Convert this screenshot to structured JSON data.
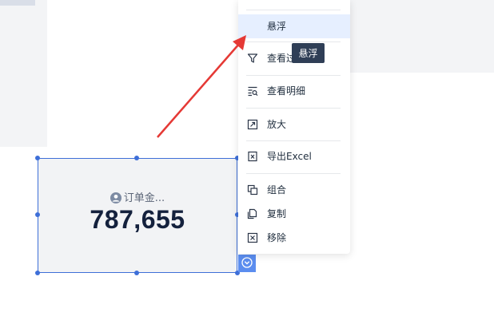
{
  "widget": {
    "label": "订单金...",
    "value": "787,655"
  },
  "menu": {
    "items": [
      {
        "label": "悬浮",
        "icon": "none"
      },
      {
        "label": "查看过",
        "icon": "filter-icon"
      },
      {
        "label": "查看明细",
        "icon": "details-icon"
      },
      {
        "label": "放大",
        "icon": "expand-icon"
      },
      {
        "label": "导出Excel",
        "icon": "excel-icon"
      },
      {
        "label": "组合",
        "icon": "group-icon"
      },
      {
        "label": "复制",
        "icon": "copy-icon"
      },
      {
        "label": "移除",
        "icon": "remove-icon"
      }
    ]
  },
  "tooltip": {
    "text": "悬浮"
  },
  "colors": {
    "accent": "#3e6fd8",
    "menu_hover": "#e6efff",
    "tooltip_bg": "#2f3e56",
    "arrow": "#e53935"
  }
}
